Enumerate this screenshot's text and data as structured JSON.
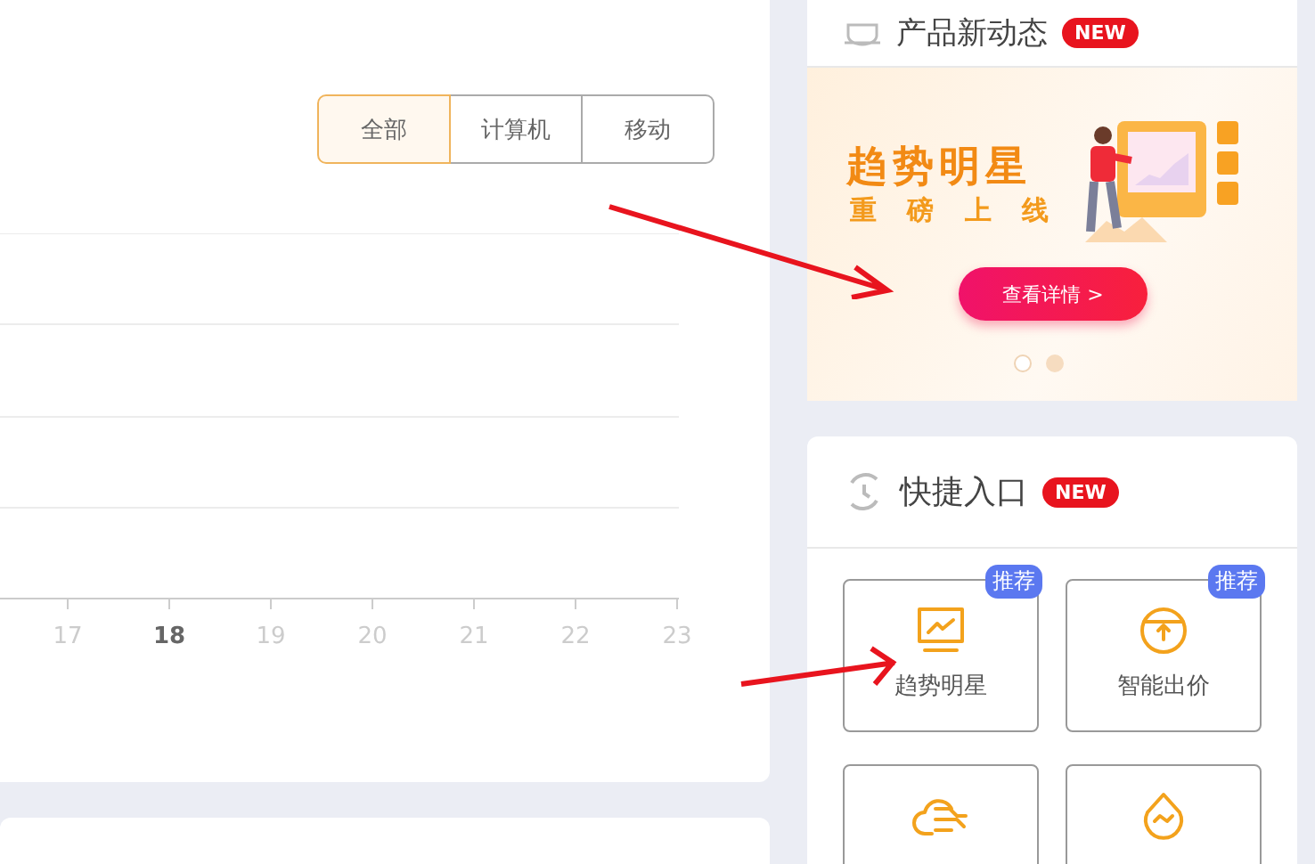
{
  "filter_tabs": [
    {
      "label": "全部",
      "selected": true
    },
    {
      "label": "计算机",
      "selected": false
    },
    {
      "label": "移动",
      "selected": false
    }
  ],
  "axis_labels": [
    {
      "label": "17",
      "highlighted": false
    },
    {
      "label": "18",
      "highlighted": true
    },
    {
      "label": "19",
      "highlighted": false
    },
    {
      "label": "20",
      "highlighted": false
    },
    {
      "label": "21",
      "highlighted": false
    },
    {
      "label": "22",
      "highlighted": false
    },
    {
      "label": "23",
      "highlighted": false
    }
  ],
  "news_card": {
    "title": "产品新动态",
    "badge": "NEW",
    "banner": {
      "headline": "趋势明星",
      "subline": "重 磅 上 线",
      "button": "查看详情 >"
    },
    "slides": [
      {
        "selected": true
      },
      {
        "selected": false
      }
    ]
  },
  "quick_entry": {
    "title": "快捷入口",
    "badge": "NEW",
    "tiles": [
      {
        "kind": "monitor",
        "label": "趋势明星",
        "badge": "推荐"
      },
      {
        "kind": "bid",
        "label": "智能出价",
        "badge": "推荐"
      },
      {
        "kind": "cloud"
      },
      {
        "kind": "drop"
      }
    ]
  }
}
